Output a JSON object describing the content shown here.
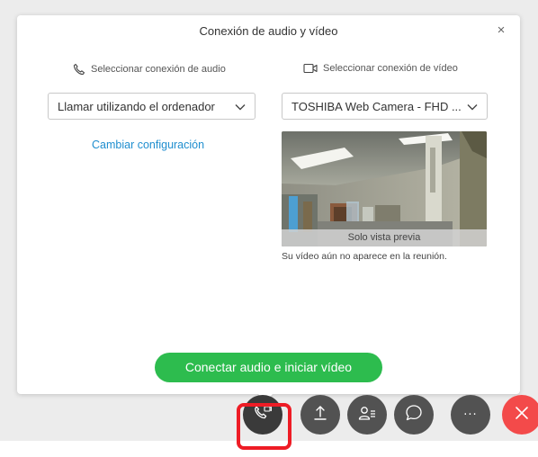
{
  "modal": {
    "title": "Conexión de audio y vídeo",
    "close_glyph": "×"
  },
  "audio": {
    "heading": "Seleccionar conexión de audio",
    "heading_icon": "phone-icon",
    "selected": "Llamar utilizando el ordenador",
    "change_settings_link": "Cambiar configuración"
  },
  "video": {
    "heading": "Seleccionar conexión de vídeo",
    "heading_icon": "video-camera-icon",
    "selected": "TOSHIBA Web Camera - FHD ...",
    "preview_caption": "Solo vista previa",
    "preview_note": "Su vídeo aún no aparece en la reunión."
  },
  "primary_action": {
    "label": "Conectar audio e iniciar vídeo",
    "color": "#2dbc4e"
  },
  "control_bar": {
    "items": [
      {
        "name": "audio-connection-icon",
        "highlighted": true
      },
      {
        "name": "share-upload-icon"
      },
      {
        "name": "participants-icon"
      },
      {
        "name": "chat-bubble-icon"
      },
      {
        "name": "more-options-icon",
        "glyph": "···"
      },
      {
        "name": "close-x-icon",
        "color": "#f34a4a"
      }
    ],
    "highlight_color": "#ee1c25"
  }
}
